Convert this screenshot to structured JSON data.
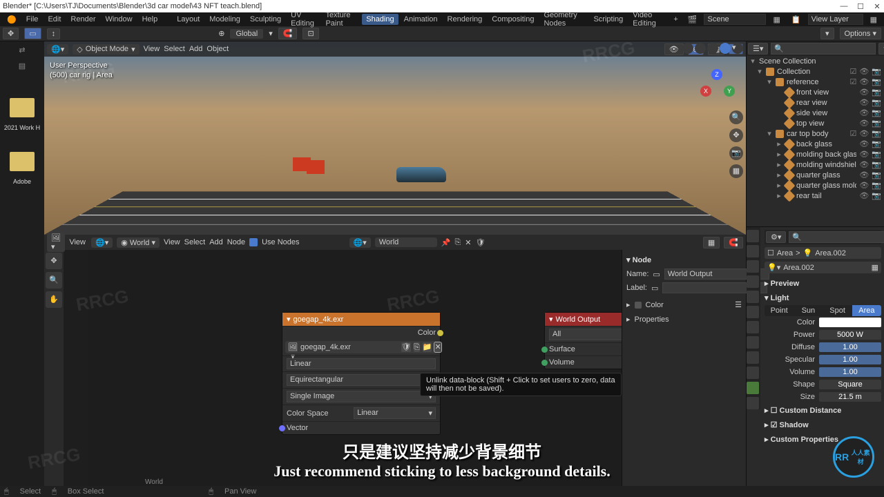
{
  "title": "Blender* [C:\\Users\\TJ\\Documents\\Blender\\3d car model\\43 NFT teach.blend]",
  "menu": {
    "file": "File",
    "edit": "Edit",
    "render": "Render",
    "window": "Window",
    "help": "Help"
  },
  "workspaces": [
    "Layout",
    "Modeling",
    "Sculpting",
    "UV Editing",
    "Texture Paint",
    "Shading",
    "Animation",
    "Rendering",
    "Compositing",
    "Geometry Nodes",
    "Scripting",
    "Video Editing"
  ],
  "scene_field": {
    "label": "Scene",
    "value": "Scene"
  },
  "viewlayer_field": {
    "value": "View Layer"
  },
  "topbar": {
    "snap": "Global"
  },
  "viewport": {
    "mode": "Object Mode",
    "menus": [
      "View",
      "Select",
      "Add",
      "Object"
    ],
    "info_line1": "User Perspective",
    "info_line2": "(500) car rig | Area",
    "axes": {
      "x": "X",
      "y": "Y",
      "z": "Z"
    }
  },
  "desktop": {
    "folder1": "2021 Work H",
    "folder2": "Adobe"
  },
  "node_editor": {
    "type": "World",
    "menus": [
      "View",
      "Select",
      "Add",
      "Node"
    ],
    "use_nodes": "Use Nodes",
    "world_sel": "World",
    "env_node": {
      "title": "goegap_4k.exr",
      "out_color": "Color",
      "image": "goegap_4k.exr",
      "interp": "Linear",
      "proj": "Equirectangular",
      "src": "Single Image",
      "cspace_label": "Color Space",
      "cspace": "Linear",
      "vector": "Vector"
    },
    "out_node": {
      "title": "World Output",
      "target": "All",
      "surface": "Surface",
      "volume": "Volume"
    },
    "tooltip": "Unlink data-block (Shift + Click to set users to zero, data will then not be saved).",
    "side": {
      "heading": "Node",
      "name_label": "Name:",
      "name": "World Output",
      "label_label": "Label:",
      "color": "Color",
      "properties": "Properties"
    },
    "bottom_label": "World"
  },
  "outliner": {
    "root": "Scene Collection",
    "collection": "Collection",
    "reference": "reference",
    "ref_items": [
      "front view",
      "rear view",
      "side view",
      "top view"
    ],
    "car": "car top body",
    "car_items": [
      "back glass",
      "molding back glass",
      "molding windshield",
      "quarter glass",
      "quarter glass molding",
      "rear tail"
    ]
  },
  "props": {
    "breadcrumb1": "Area",
    "breadcrumb2": "Area.002",
    "datablock": "Area.002",
    "preview": "Preview",
    "light": "Light",
    "types": [
      "Point",
      "Sun",
      "Spot",
      "Area"
    ],
    "color": "Color",
    "power_label": "Power",
    "power": "5000 W",
    "diffuse_label": "Diffuse",
    "diffuse": "1.00",
    "specular_label": "Specular",
    "specular": "1.00",
    "volume_label": "Volume",
    "volume": "1.00",
    "shape_label": "Shape",
    "shape": "Square",
    "size_label": "Size",
    "size": "21.5 m",
    "custom_distance": "Custom Distance",
    "shadow": "Shadow",
    "custom_props": "Custom Properties"
  },
  "status": {
    "select": "Select",
    "box": "Box Select",
    "pan": "Pan View"
  },
  "uv_header": {
    "view": "View"
  },
  "subtitle": {
    "zh": "只是建议坚持减少背景细节",
    "en": "Just recommend sticking to less background details."
  },
  "watermark": "RRCG",
  "logo_sub": "人人素材"
}
